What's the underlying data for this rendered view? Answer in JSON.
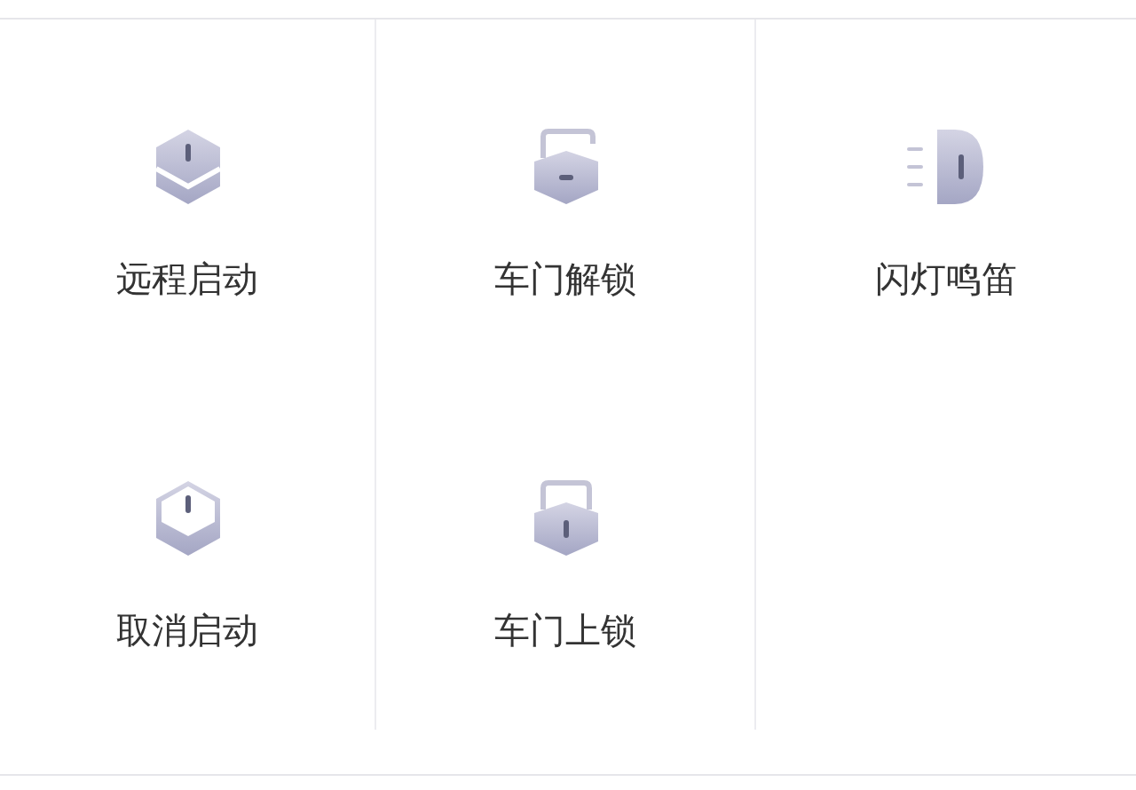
{
  "actions": [
    {
      "kind": "start",
      "label": "远程启动"
    },
    {
      "kind": "unlock",
      "label": "车门解锁"
    },
    {
      "kind": "flash",
      "label": "闪灯鸣笛"
    },
    {
      "kind": "cancel",
      "label": "取消启动"
    },
    {
      "kind": "lock",
      "label": "车门上锁"
    }
  ]
}
